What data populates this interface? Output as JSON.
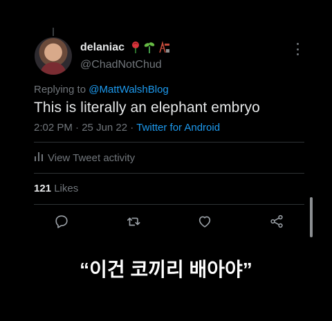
{
  "tweet": {
    "display_name": "delaniac",
    "emoji": [
      "rose-emoji",
      "seedling-emoji",
      "oil-derrick-emoji"
    ],
    "handle": "@ChadNotChud",
    "reply_prefix": "Replying to",
    "reply_mention": "@MattWalshBlog",
    "text": "This is literally an elephant embryo",
    "time": "2:02 PM",
    "date": "25 Jun 22",
    "separator": "·",
    "source": "Twitter for Android",
    "activity_label": "View Tweet activity",
    "likes_count": "121",
    "likes_label": "Likes"
  },
  "actions": [
    "reply-icon",
    "retweet-icon",
    "like-icon",
    "share-icon"
  ],
  "caption": "“이건 코끼리 배아야”",
  "colors": {
    "background": "#000000",
    "primary_text": "#e7e9ea",
    "secondary_text": "#71767b",
    "link": "#1d9bf0",
    "divider": "#2f3336"
  }
}
